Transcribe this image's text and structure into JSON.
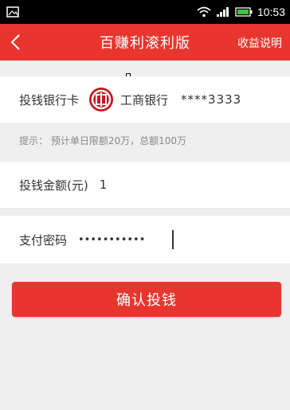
{
  "status_bar": {
    "time": "10:53"
  },
  "nav": {
    "title": "百赚利滚利版",
    "right_label": "收益说明"
  },
  "card_row": {
    "label": "投钱银行卡",
    "bank_name": "工商银行",
    "card_number": "****3333"
  },
  "hint": "提示： 预计单日限额20万，总额100万",
  "amount_row": {
    "label": "投钱金额(元)",
    "value": "1"
  },
  "password_row": {
    "label": "支付密码",
    "masked_value": "•••••••••••"
  },
  "confirm_button": {
    "label": "确认投钱"
  },
  "colors": {
    "brand_red": "#e8362f",
    "background": "#efefef"
  },
  "icons": [
    "back-arrow-icon",
    "icbc-logo-icon",
    "wifi-icon",
    "signal-icon",
    "battery-icon",
    "image-notification-icon"
  ]
}
